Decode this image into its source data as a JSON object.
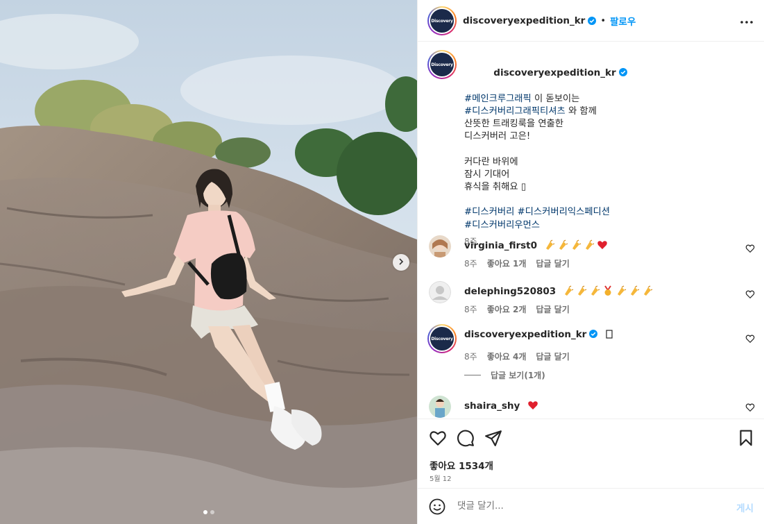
{
  "photo": {
    "next_icon": "chevron-right-icon",
    "dots": 2,
    "active_dot": 0
  },
  "header": {
    "username": "discoveryexpedition_kr",
    "avatar_text": "Discovery",
    "separator": "•",
    "follow_label": "팔로우",
    "more_icon": "more-horizontal-icon"
  },
  "caption": {
    "username": "discoveryexpedition_kr",
    "lines": [
      {
        "tag": "#메인크루그래픽",
        "text": " 이 돋보이는"
      },
      {
        "tag": "#디스커버리그래픽티셔츠",
        "text": " 와 함께"
      },
      {
        "tag": "",
        "text": "산뜻한 트래킹룩을 연출한"
      },
      {
        "tag": "",
        "text": "디스커버러 고은!"
      },
      {
        "tag": "",
        "text": ""
      },
      {
        "tag": "",
        "text": "커다란 바위에"
      },
      {
        "tag": "",
        "text": "잠시 기대어"
      },
      {
        "tag": "",
        "text": "휴식을 취해요 ▯"
      },
      {
        "tag": "",
        "text": ""
      },
      {
        "tag": "#디스커버리 #디스커버리익스페디션",
        "text": ""
      },
      {
        "tag": "#디스커버리우먼스",
        "text": ""
      }
    ],
    "time": "8주"
  },
  "comments": [
    {
      "username": "virginia_first0",
      "emojis": [
        "clap",
        "clap",
        "clap",
        "clap",
        "heart"
      ],
      "time": "8주",
      "likes": "좋아요 1개",
      "reply": "답글 달기"
    },
    {
      "username": "delephing520803",
      "emojis": [
        "clap",
        "clap",
        "clap",
        "medal",
        "clap",
        "clap",
        "clap"
      ],
      "time": "8주",
      "likes": "좋아요 2개",
      "reply": "답글 달기"
    },
    {
      "username": "discoveryexpedition_kr",
      "emojis": [
        "box"
      ],
      "time": "8주",
      "likes": "좋아요 4개",
      "reply": "답글 달기"
    },
    {
      "username": "shaira_shy",
      "emojis": [
        "heart"
      ],
      "time": "",
      "likes": "",
      "reply": ""
    }
  ],
  "view_replies": "답글 보기(1개)",
  "actions": {
    "like_icon": "heart-icon",
    "comment_icon": "comment-icon",
    "share_icon": "send-icon",
    "save_icon": "bookmark-icon",
    "likes_text": "좋아요 1534개",
    "date": "5월 12"
  },
  "add_comment": {
    "emoji_icon": "smiley-icon",
    "placeholder": "댓글 달기...",
    "post_label": "게시"
  },
  "colors": {
    "link": "#00376b",
    "follow": "#0095f6",
    "post_disabled": "#b3dbff",
    "heart": "#ed4956",
    "verified": "#0095f6"
  }
}
